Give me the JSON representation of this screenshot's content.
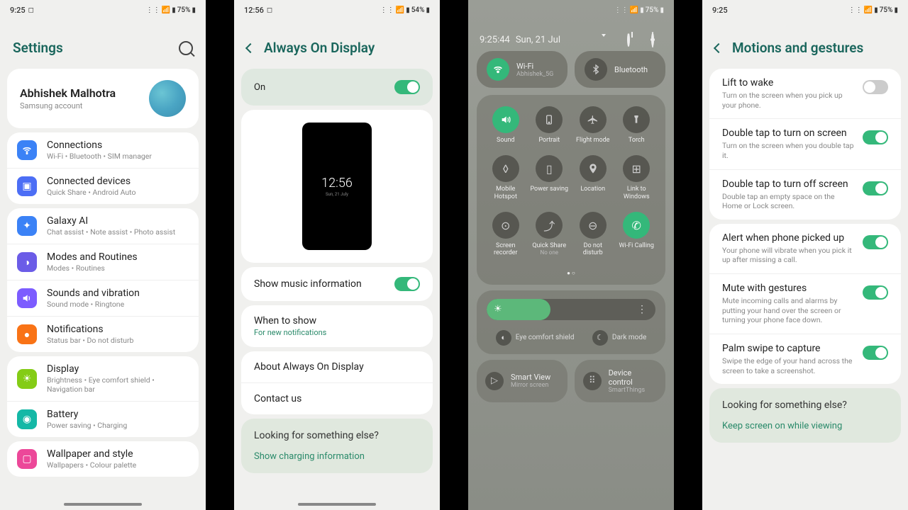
{
  "s1": {
    "status": {
      "time": "9:25",
      "battery": "75%"
    },
    "title": "Settings",
    "account": {
      "name": "Abhishek Malhotra",
      "sub": "Samsung account"
    },
    "g1": [
      {
        "title": "Connections",
        "sub": "Wi-Fi  •  Bluetooth  •  SIM manager"
      },
      {
        "title": "Connected devices",
        "sub": "Quick Share  •  Android Auto"
      }
    ],
    "g2": [
      {
        "title": "Galaxy AI",
        "sub": "Chat assist  •  Note assist  •  Photo assist"
      },
      {
        "title": "Modes and Routines",
        "sub": "Modes  •  Routines"
      },
      {
        "title": "Sounds and vibration",
        "sub": "Sound mode  •  Ringtone"
      },
      {
        "title": "Notifications",
        "sub": "Status bar  •  Do not disturb"
      }
    ],
    "g3": [
      {
        "title": "Display",
        "sub": "Brightness  •  Eye comfort shield  •  Navigation bar"
      },
      {
        "title": "Battery",
        "sub": "Power saving  •  Charging"
      }
    ],
    "g4": [
      {
        "title": "Wallpaper and style",
        "sub": "Wallpapers  •  Colour palette"
      }
    ]
  },
  "s2": {
    "status": {
      "time": "12:56",
      "battery": "54%"
    },
    "title": "Always On Display",
    "on_label": "On",
    "preview_time": "12:56",
    "preview_date": "Sun, 21 July",
    "music": "Show music information",
    "when": {
      "title": "When to show",
      "sub": "For new notifications"
    },
    "about": "About Always On Display",
    "contact": "Contact us",
    "footer_title": "Looking for something else?",
    "footer_link": "Show charging information"
  },
  "s3": {
    "time": "9:25:44",
    "date": "Sun, 21 Jul",
    "battery": "75%",
    "wifi": {
      "title": "Wi-Fi",
      "sub": "Abhishek_5G"
    },
    "bt": "Bluetooth",
    "tiles": [
      [
        {
          "label": "Sound",
          "active": true
        },
        {
          "label": "Portrait"
        },
        {
          "label": "Flight\nmode"
        },
        {
          "label": "Torch"
        }
      ],
      [
        {
          "label": "Mobile\nHotspot"
        },
        {
          "label": "Power\nsaving"
        },
        {
          "label": "Location"
        },
        {
          "label": "Link to\nWindows"
        }
      ],
      [
        {
          "label": "Screen\nrecorder"
        },
        {
          "label": "Quick Share",
          "sub": "No one"
        },
        {
          "label": "Do not\ndisturb"
        },
        {
          "label": "Wi-Fi Calling",
          "active": true
        }
      ]
    ],
    "eye": "Eye comfort shield",
    "dark": "Dark mode",
    "smartview": {
      "title": "Smart View",
      "sub": "Mirror screen"
    },
    "device": {
      "title": "Device control",
      "sub": "SmartThings"
    }
  },
  "s4": {
    "status": {
      "time": "9:25",
      "battery": "75%"
    },
    "title": "Motions and gestures",
    "g1": [
      {
        "title": "Lift to wake",
        "sub": "Turn on the screen when you pick up your phone.",
        "on": false
      },
      {
        "title": "Double tap to turn on screen",
        "sub": "Turn on the screen when you double tap it.",
        "on": true
      },
      {
        "title": "Double tap to turn off screen",
        "sub": "Double tap an empty space on the Home or Lock screen.",
        "on": true
      }
    ],
    "g2": [
      {
        "title": "Alert when phone picked up",
        "sub": "Your phone will vibrate when you pick it up after missing a call.",
        "on": true
      },
      {
        "title": "Mute with gestures",
        "sub": "Mute incoming calls and alarms by putting your hand over the screen or turning your phone face down.",
        "on": true
      },
      {
        "title": "Palm swipe to capture",
        "sub": "Swipe the edge of your hand across the screen to take a screenshot.",
        "on": true
      }
    ],
    "footer_title": "Looking for something else?",
    "footer_link": "Keep screen on while viewing"
  }
}
